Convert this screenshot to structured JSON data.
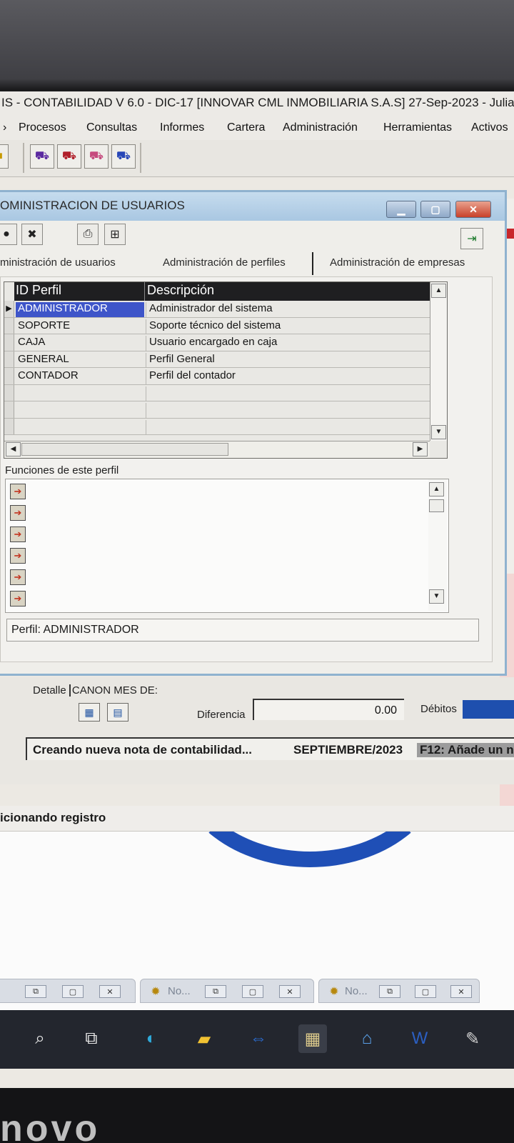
{
  "app": {
    "title": "IS - CONTABILIDAD V 6.0 - DIC-17 [INNOVAR CML INMOBILIARIA S.A.S] 27-Sep-2023 - Julia",
    "menu": [
      "Procesos",
      "Consultas",
      "Informes",
      "Cartera",
      "Administración",
      "Herramientas",
      "Activos"
    ]
  },
  "dialog": {
    "title": "OMINISTRACION DE USUARIOS",
    "tabs": [
      "ministración de usuarios",
      "Administración de perfiles",
      "Administración de empresas"
    ],
    "grid": {
      "columns": [
        "ID Perfil",
        "Descripción"
      ],
      "rows": [
        {
          "id": "ADMINISTRADOR",
          "desc": "Administrador del sistema"
        },
        {
          "id": "SOPORTE",
          "desc": "Soporte técnico del sistema"
        },
        {
          "id": "CAJA",
          "desc": "Usuario encargado en caja"
        },
        {
          "id": "GENERAL",
          "desc": "Perfil General"
        },
        {
          "id": "CONTADOR",
          "desc": "Perfil del contador"
        }
      ]
    },
    "functions_label": "Funciones de este perfil",
    "status": "Perfil: ADMINISTRADOR"
  },
  "lower": {
    "detalle": "Detalle",
    "canon": "CANON MES DE:",
    "diferencia_label": "Diferencia",
    "diferencia_value": "0.00",
    "debitos_label": "Débitos",
    "status_text": "Creando nueva nota de contabilidad...",
    "period": "SEPTIEMBRE/2023",
    "f12": "F12: Añade un n",
    "adding": "icionando registro"
  },
  "taskbar_windows": [
    {
      "label": ""
    },
    {
      "label": "No..."
    },
    {
      "label": "No..."
    }
  ],
  "bezel": "novo"
}
